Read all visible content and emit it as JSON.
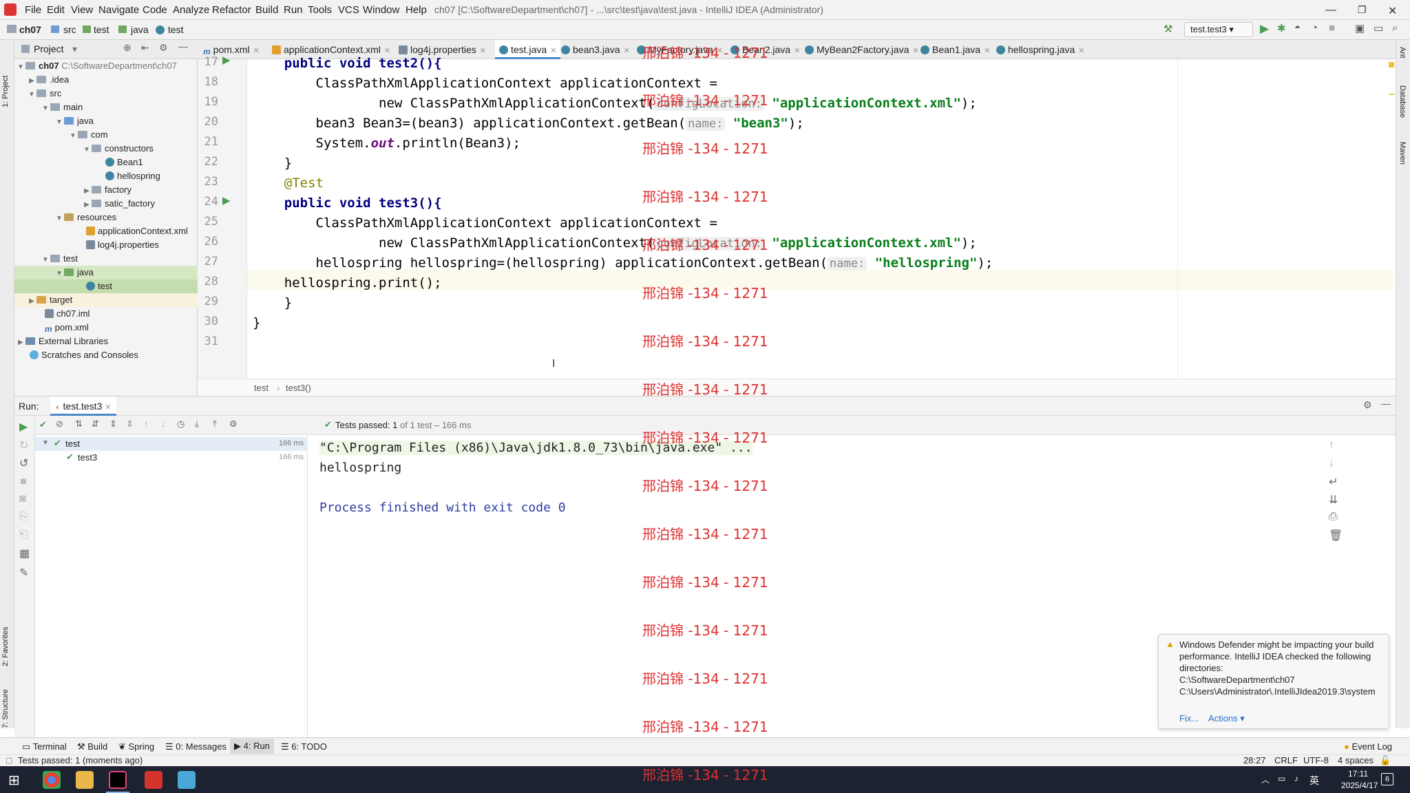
{
  "menubar": {
    "items": [
      "File",
      "Edit",
      "View",
      "Navigate",
      "Code",
      "Analyze",
      "Refactor",
      "Build",
      "Run",
      "Tools",
      "VCS",
      "Window",
      "Help"
    ],
    "title": "ch07 [C:\\SoftwareDepartment\\ch07] - ...\\src\\test\\java\\test.java - IntelliJ IDEA (Administrator)"
  },
  "navbar": {
    "crumbs": [
      "ch07",
      "src",
      "test",
      "java",
      "test"
    ],
    "run_config": "test.test3"
  },
  "tabs": [
    {
      "label": "pom.xml",
      "icon": "m"
    },
    {
      "label": "applicationContext.xml",
      "icon": "xml"
    },
    {
      "label": "log4j.properties",
      "icon": "prop"
    },
    {
      "label": "test.java",
      "icon": "cls"
    },
    {
      "label": "bean3.java",
      "icon": "cls"
    },
    {
      "label": "MyFactory.java",
      "icon": "cls"
    },
    {
      "label": "Bean2.java",
      "icon": "cls"
    },
    {
      "label": "MyBean2Factory.java",
      "icon": "cls"
    },
    {
      "label": "Bean1.java",
      "icon": "cls"
    },
    {
      "label": "hellospring.java",
      "icon": "cls"
    }
  ],
  "project": {
    "header": "Project",
    "root": "ch07",
    "root_path": "C:\\SoftwareDepartment\\ch07",
    "items": [
      ".idea",
      "src",
      "main",
      "java",
      "com",
      "constructors",
      "Bean1",
      "hellospring",
      "factory",
      "satic_factory",
      "resources",
      "applicationContext.xml",
      "log4j.properties",
      "test",
      "java",
      "test",
      "target",
      "ch07.iml",
      "pom.xml",
      "External Libraries",
      "Scratches and Consoles"
    ]
  },
  "editor": {
    "line_numbers": [
      "17",
      "18",
      "19",
      "20",
      "21",
      "22",
      "23",
      "24",
      "25",
      "26",
      "27",
      "28",
      "29",
      "30",
      "31"
    ],
    "lines": {
      "l17": "    public void test2(){",
      "l18a": "        ClassPathXmlApplicationContext applicationContext =",
      "l19a": "                new ClassPathXmlApplicationContext(",
      "l19hint": "configLocation:",
      "l19str": "\"applicationContext.xml\"",
      "l20a": "        bean3 Bean3=(bean3) applicationContext.getBean(",
      "l20hint": "name:",
      "l20str": "\"bean3\"",
      "l21a": "        System.",
      "l21b": "out",
      "l21c": ".println(Bean3);",
      "l22": "    }",
      "l23": "    @Test",
      "l24": "    public void test3(){",
      "l25": "        ClassPathXmlApplicationContext applicationContext =",
      "l26a": "                new ClassPathXmlApplicationContext(",
      "l26hint": "configLocation:",
      "l26str": "\"applicationContext.xml\"",
      "l27a": "        hellospring hellospring=(hellospring) applicationContext.getBean(",
      "l27hint": "name:",
      "l27str": "\"hellospring\"",
      "l28": "    hellospring.print();",
      "l29": "    }",
      "l30": "}",
      "l31": ""
    },
    "breadcrumb": [
      "test",
      "test3()"
    ]
  },
  "watermark": "邢泊锦 -134 - 1271",
  "run": {
    "label": "Run:",
    "tab": "test.test3",
    "status": "Tests passed: 1",
    "status_detail": "of 1 test – 166 ms",
    "tree": [
      {
        "name": "test",
        "time": "166 ms"
      },
      {
        "name": "test3",
        "time": "166 ms"
      }
    ],
    "console": [
      "\"C:\\Program Files (x86)\\Java\\jdk1.8.0_73\\bin\\java.exe\" ...",
      "hellospring",
      "",
      "Process finished with exit code 0"
    ]
  },
  "notification": {
    "text": "Windows Defender might be impacting your build performance. IntelliJ IDEA checked the following directories:",
    "dirs": [
      "C:\\SoftwareDepartment\\ch07",
      "C:\\Users\\Administrator\\.IntelliJIdea2019.3\\system"
    ],
    "fix": "Fix...",
    "actions": "Actions ▾"
  },
  "toolwindows": [
    "Terminal",
    "Build",
    "Spring",
    "0: Messages",
    "4: Run",
    "6: TODO"
  ],
  "eventlog": "Event Log",
  "status": {
    "left": "Tests passed: 1 (moments ago)",
    "pos": "28:27",
    "eol": "CRLF",
    "enc": "UTF-8",
    "indent": "4 spaces"
  },
  "taskbar": {
    "time": "17:11",
    "date": "2025/4/17",
    "ime": "英",
    "notif_count": "6"
  },
  "sidebars": {
    "left": [
      "1: Project",
      "2: Favorites",
      "7: Structure"
    ],
    "right": [
      "Ant",
      "Database",
      "Maven"
    ]
  }
}
